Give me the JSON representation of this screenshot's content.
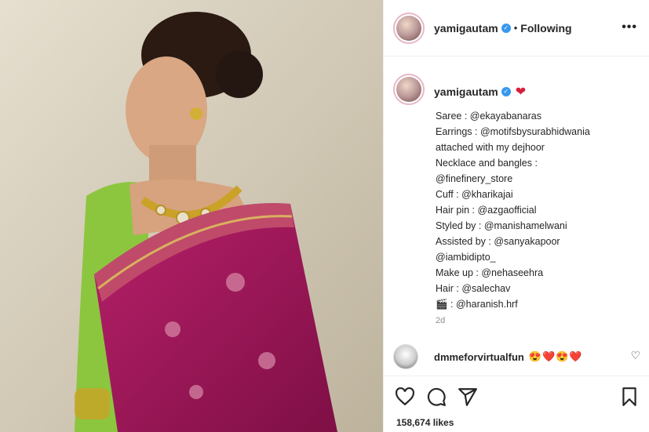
{
  "post": {
    "username": "yamigautam",
    "following_label": "Following",
    "more_label": "•••",
    "caption_lines": [
      "Saree : @ekayabanaras",
      "Earrings : @motifsbysurabhidwania",
      "attached with my dejhoor",
      "Necklace and bangles :",
      "@finefinery_store",
      "Cuff : @kharikajai",
      "Hair pin : @azgaofficial",
      "Styled by : @manishamelwani",
      "Assisted by : @sanyakapoor",
      "@iambidipto_",
      "Make up : @nehaseehra",
      "Hair : @salechav",
      "🎬 : @haranish.hrf"
    ],
    "time_ago": "2d",
    "likes": "158,674 likes"
  },
  "comment": {
    "username": "dmmeforvirtualfun",
    "emojis": "😍❤️😍❤️"
  },
  "colors": {
    "verified": "#3897f0",
    "saree": "#a31a5a",
    "blouse": "#8cc63f"
  },
  "icons": [
    "heart-icon",
    "comment-icon",
    "share-icon",
    "bookmark-icon",
    "more-icon",
    "verified-icon"
  ]
}
